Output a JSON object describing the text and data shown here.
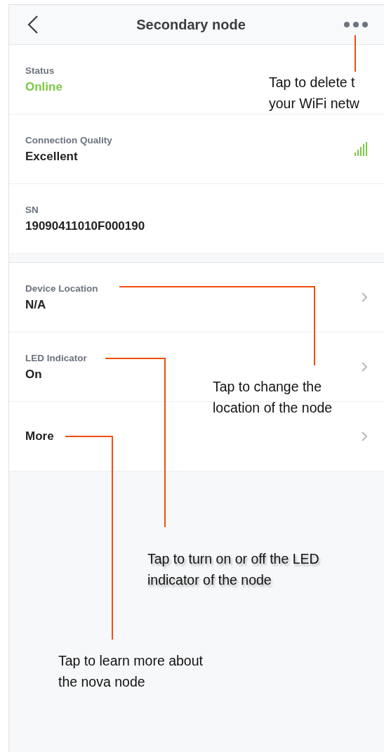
{
  "header": {
    "title": "Secondary node"
  },
  "info_rows": [
    {
      "kind": "status",
      "label": "Status",
      "value": "Online"
    },
    {
      "kind": "signal",
      "label": "Connection Quality",
      "value": "Excellent"
    },
    {
      "kind": "text",
      "label": "SN",
      "value": "19090411010F000190"
    }
  ],
  "nav_rows": [
    {
      "kind": "pair",
      "label": "Device Location",
      "value": "N/A"
    },
    {
      "kind": "pair",
      "label": "LED Indicator",
      "value": "On"
    },
    {
      "kind": "single",
      "value": "More"
    }
  ],
  "callouts": [
    {
      "lines": [
        "Tap to delete t",
        "your WiFi netw"
      ]
    },
    {
      "lines": [
        "Tap to change the",
        "location of the node"
      ]
    },
    {
      "lines": [
        "Tap to turn on or off the LED",
        "indicator of the node"
      ]
    },
    {
      "lines": [
        "Tap to learn more about",
        "the nova node"
      ]
    }
  ]
}
